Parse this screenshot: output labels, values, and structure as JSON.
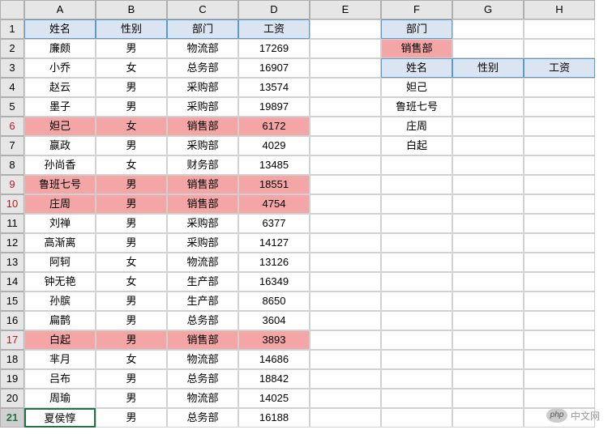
{
  "columns": [
    "A",
    "B",
    "C",
    "D",
    "E",
    "F",
    "G",
    "H"
  ],
  "rowNumbers": [
    1,
    2,
    3,
    4,
    5,
    6,
    7,
    8,
    9,
    10,
    11,
    12,
    13,
    14,
    15,
    16,
    17,
    18,
    19,
    20,
    21
  ],
  "highlightedRowHeads": [
    6,
    9,
    10,
    17
  ],
  "mainHeaders": {
    "A": "姓名",
    "B": "性别",
    "C": "部门",
    "D": "工资"
  },
  "mainData": [
    {
      "A": "廉颇",
      "B": "男",
      "C": "物流部",
      "D": "17269",
      "hl": false
    },
    {
      "A": "小乔",
      "B": "女",
      "C": "总务部",
      "D": "16907",
      "hl": false
    },
    {
      "A": "赵云",
      "B": "男",
      "C": "采购部",
      "D": "13574",
      "hl": false
    },
    {
      "A": "墨子",
      "B": "男",
      "C": "采购部",
      "D": "19897",
      "hl": false
    },
    {
      "A": "妲己",
      "B": "女",
      "C": "销售部",
      "D": "6172",
      "hl": true
    },
    {
      "A": "嬴政",
      "B": "男",
      "C": "采购部",
      "D": "4029",
      "hl": false
    },
    {
      "A": "孙尚香",
      "B": "女",
      "C": "财务部",
      "D": "13485",
      "hl": false
    },
    {
      "A": "鲁班七号",
      "B": "男",
      "C": "销售部",
      "D": "18551",
      "hl": true
    },
    {
      "A": "庄周",
      "B": "男",
      "C": "销售部",
      "D": "4754",
      "hl": true
    },
    {
      "A": "刘禅",
      "B": "男",
      "C": "采购部",
      "D": "6377",
      "hl": false
    },
    {
      "A": "高渐离",
      "B": "男",
      "C": "采购部",
      "D": "14127",
      "hl": false
    },
    {
      "A": "阿轲",
      "B": "女",
      "C": "物流部",
      "D": "13126",
      "hl": false
    },
    {
      "A": "钟无艳",
      "B": "女",
      "C": "生产部",
      "D": "16349",
      "hl": false
    },
    {
      "A": "孙膑",
      "B": "男",
      "C": "生产部",
      "D": "8650",
      "hl": false
    },
    {
      "A": "扁鹊",
      "B": "男",
      "C": "总务部",
      "D": "3604",
      "hl": false
    },
    {
      "A": "白起",
      "B": "男",
      "C": "销售部",
      "D": "3893",
      "hl": true
    },
    {
      "A": "芈月",
      "B": "女",
      "C": "物流部",
      "D": "14686",
      "hl": false
    },
    {
      "A": "吕布",
      "B": "男",
      "C": "总务部",
      "D": "18842",
      "hl": false
    },
    {
      "A": "周瑜",
      "B": "男",
      "C": "物流部",
      "D": "14025",
      "hl": false
    },
    {
      "A": "夏侯惇",
      "B": "男",
      "C": "总务部",
      "D": "16188",
      "hl": false
    }
  ],
  "side": {
    "F1": "部门",
    "F2": "销售部",
    "F3": "姓名",
    "G3": "性别",
    "H3": "工资",
    "F4": "妲己",
    "F5": "鲁班七号",
    "F6": "庄周",
    "F7": "白起"
  },
  "watermark": {
    "php": "php",
    "text": "中文网"
  }
}
